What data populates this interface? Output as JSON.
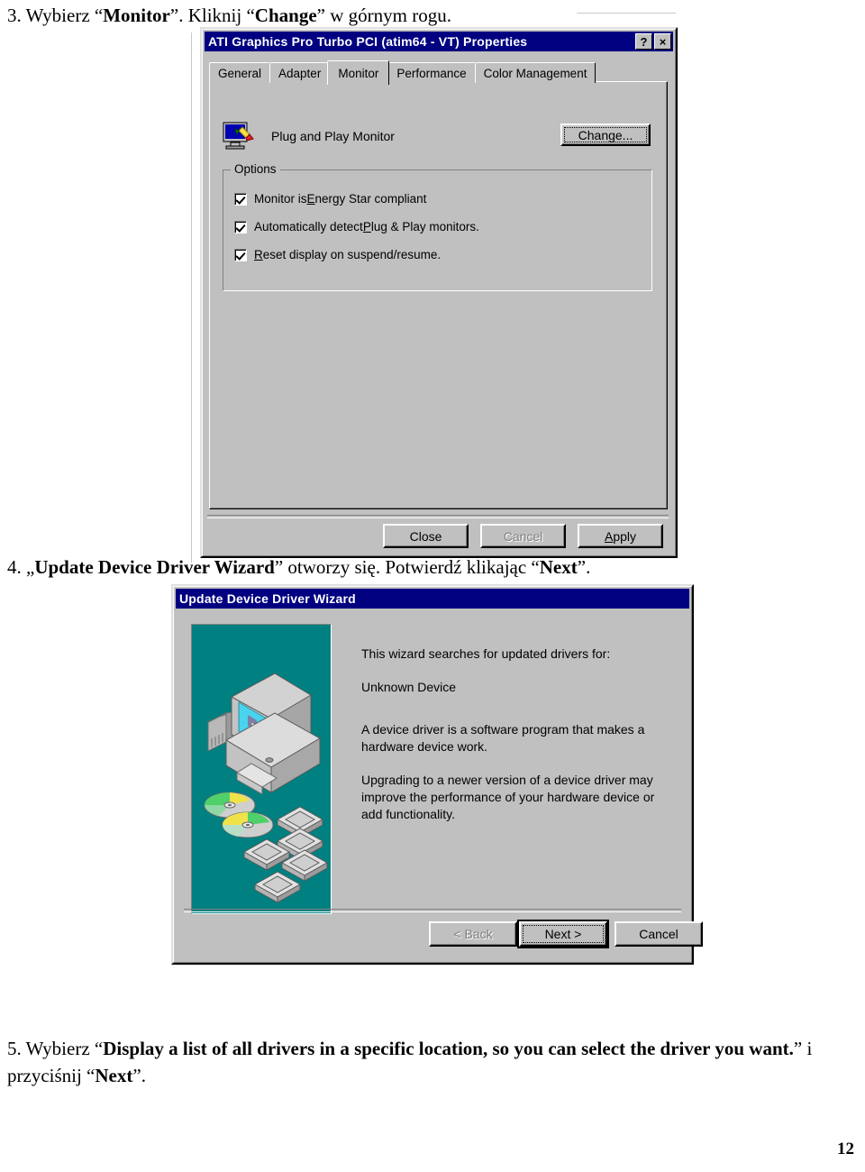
{
  "page": {
    "number": "12",
    "language": "pl"
  },
  "steps": {
    "step3": {
      "number": "3.",
      "prefix": "Wybierz “",
      "bold1": "Monitor",
      "middle": "”. Kliknij “",
      "bold2": "Change",
      "suffix": "” w górnym rogu."
    },
    "step4": {
      "number": "4.",
      "prefix": "„",
      "bold1": "Update Device Driver Wizard",
      "middle": "” otworzy się. Potwierdź klikając “",
      "bold2": "Next",
      "suffix": "”."
    },
    "step5": {
      "number": "5.",
      "prefix": "Wybierz “",
      "bold1": "Display a list of all drivers in a specific location, so you can select the driver you want.",
      "middle": "” i przyciśnij “",
      "bold2": "Next",
      "suffix": "”."
    }
  },
  "display_properties": {
    "title": "ATI Graphics Pro Turbo PCI (atim64 - VT) Properties",
    "titlebar_buttons": [
      {
        "name": "help-button",
        "glyph": "?"
      },
      {
        "name": "close-button",
        "glyph": "×"
      }
    ],
    "tabs": [
      {
        "label": "General",
        "active": false
      },
      {
        "label": "Adapter",
        "active": false
      },
      {
        "label": "Monitor",
        "active": true
      },
      {
        "label": "Performance",
        "active": false
      },
      {
        "label": "Color Management",
        "active": false
      }
    ],
    "monitor_name": "Plug and Play Monitor",
    "monitor_icon": "monitor-pencil-icon",
    "change_button": "Change...",
    "options_group_label": "Options",
    "options": [
      {
        "label_pre": "Monitor is ",
        "accel": "E",
        "label_post": "nergy Star compliant",
        "checked": true
      },
      {
        "label_pre": "Automatically detect ",
        "accel": "P",
        "label_post": "lug & Play monitors.",
        "checked": true
      },
      {
        "label_pre": "",
        "accel": "R",
        "label_post": "eset display on suspend/resume.",
        "checked": true
      }
    ],
    "buttons": [
      {
        "label": "Close",
        "accel": "",
        "disabled": false,
        "default": false
      },
      {
        "label": "Cancel",
        "accel": "",
        "disabled": true,
        "default": false
      },
      {
        "label": "Apply",
        "accel": "A",
        "disabled": false,
        "default": false
      }
    ]
  },
  "wizard": {
    "title": "Update Device Driver Wizard",
    "art_background": "#008080",
    "art_icon": "computer-cds-chips-illustration",
    "intro": "This wizard searches for updated drivers for:",
    "device": "Unknown Device",
    "paragraph1": "A device driver is a software program that makes a hardware device work.",
    "paragraph2": "Upgrading to a newer version of a device driver may improve the performance of your hardware device or add functionality.",
    "buttons": [
      {
        "label": "< Back",
        "disabled": true,
        "default": false,
        "focused": false
      },
      {
        "label": "Next >",
        "disabled": false,
        "default": true,
        "focused": true
      },
      {
        "label": "Cancel",
        "disabled": false,
        "default": false,
        "focused": false
      }
    ]
  },
  "colors": {
    "titlebar": "#000080",
    "dialog_face": "#c0c0c0",
    "wizard_art": "#008080",
    "text": "#000000"
  }
}
